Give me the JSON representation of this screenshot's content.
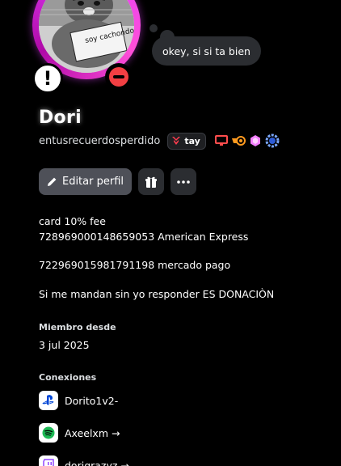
{
  "profile": {
    "avatar_caption": "soy cachondo",
    "custom_status": "okey, si si ta bien",
    "display_name": "Dori",
    "username": "entusrecuerdosperdido",
    "clan_tag": "tay",
    "badges": [
      "nitro-monitor-icon",
      "quest-icon",
      "boost-gem-icon",
      "hypesquad-icon"
    ],
    "status_color": "#f23f43",
    "ring_color": "#e040fb"
  },
  "actions": {
    "edit_label": "Editar perfil"
  },
  "bio": {
    "lines": [
      "card 10% fee",
      "728969000148659053 American Express",
      "",
      "722969015981791198 mercado pago",
      "",
      "Si me mandan sin yo responder ES DONACIÒN"
    ]
  },
  "member_since": {
    "label": "Miembro desde",
    "value": "3 jul 2025"
  },
  "connections": {
    "label": "Conexiones",
    "items": [
      {
        "service": "playstation",
        "name": "Dorito1v2-"
      },
      {
        "service": "spotify",
        "name": "Axeelxm →"
      },
      {
        "service": "twitch",
        "name": "dorigrazyz →"
      }
    ]
  }
}
